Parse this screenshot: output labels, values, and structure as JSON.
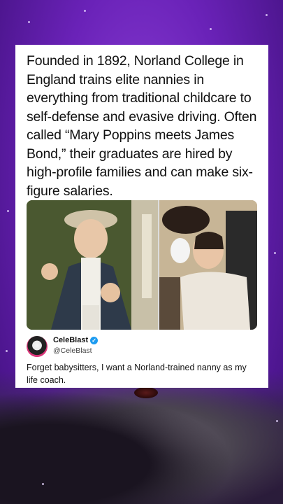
{
  "post": {
    "headline": "Founded in 1892, Norland College in England trains elite nannies in everything from traditional childcare to self-defense and evasive driving. Often called “Mary Poppins meets James Bond,” their graduates are hired by high-profile families and can make six-figure salaries.",
    "author": {
      "name": "CeleBlast",
      "handle": "@CeleBlast",
      "verified_icon": "verified-check-icon"
    },
    "comment": "Forget babysitters, I want a Norland-trained nanny as my life coach."
  },
  "colors": {
    "background": "#6a22b8",
    "card": "#ffffff",
    "verified": "#1d9bf0"
  }
}
